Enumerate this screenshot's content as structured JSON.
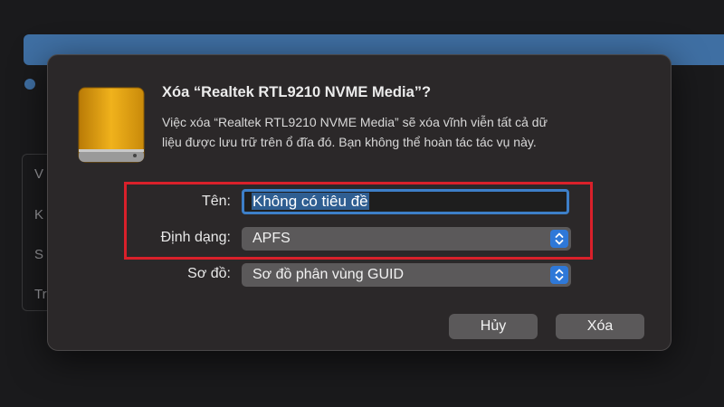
{
  "background": {
    "letters": [
      "V",
      "K",
      "S",
      "Tr"
    ]
  },
  "dialog": {
    "title": "Xóa “Realtek RTL9210 NVME Media”?",
    "message_line1": "Việc xóa “Realtek RTL9210 NVME Media” sẽ xóa vĩnh viễn tất cả dữ",
    "message_line2": "liệu được lưu trữ trên ổ đĩa đó. Bạn không thể hoàn tác tác vụ này.",
    "icon": "external-drive-icon",
    "form": {
      "name_label": "Tên:",
      "name_value": "Không có tiêu đề",
      "format_label": "Định dạng:",
      "format_value": "APFS",
      "scheme_label": "Sơ đồ:",
      "scheme_value": "Sơ đồ phân vùng GUID"
    },
    "buttons": {
      "cancel": "Hủy",
      "erase": "Xóa"
    }
  },
  "colors": {
    "accent": "#2e78d8",
    "highlight_annotation": "#d9202a",
    "drive": "#e8a614"
  }
}
